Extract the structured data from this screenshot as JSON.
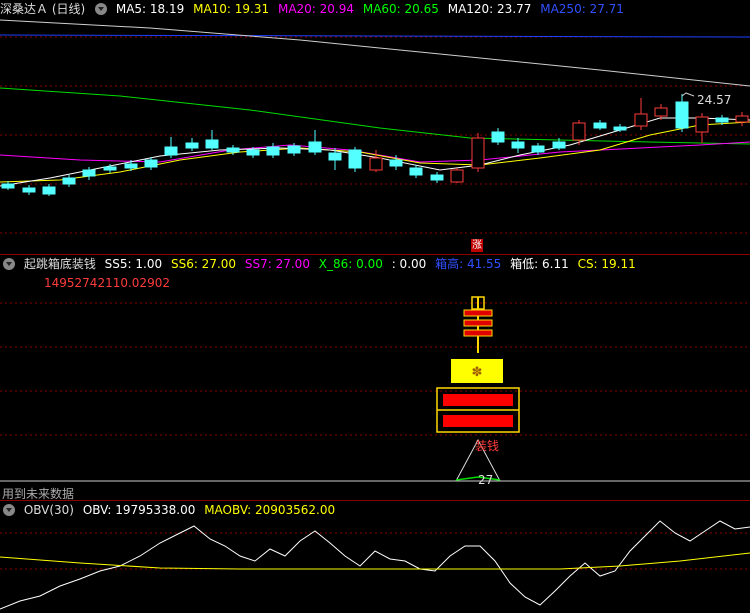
{
  "main": {
    "title": "深桑达Ａ (日线)",
    "ma": [
      {
        "label": "MA5: 18.19",
        "color": "#ffffff"
      },
      {
        "label": "MA10: 19.31",
        "color": "#ffff00"
      },
      {
        "label": "MA20: 20.94",
        "color": "#ff00ff"
      },
      {
        "label": "MA60: 20.65",
        "color": "#00ff00"
      },
      {
        "label": "MA120: 23.77",
        "color": "#ffffff"
      },
      {
        "label": "MA250: 27.71",
        "color": "#1e40ff"
      }
    ],
    "high_label": "24.57",
    "zhang_marker": "涨"
  },
  "indicator": {
    "title": "起跳箱底装钱",
    "items": [
      {
        "label": "SS5: 1.00",
        "color": "#ffffff"
      },
      {
        "label": "SS6: 27.00",
        "color": "#ffff00"
      },
      {
        "label": "SS7: 27.00",
        "color": "#ff00ff"
      },
      {
        "label": "X_86: 0.00",
        "color": "#00ff00"
      },
      {
        "label": ": 0.00",
        "color": "#ffffff"
      },
      {
        "label": "箱高: 41.55",
        "color": "#1e40ff"
      },
      {
        "label": "箱低: 6.11",
        "color": "#ffffff"
      },
      {
        "label": "CS: 19.11",
        "color": "#ffff00"
      }
    ],
    "red_number": "14952742110.02902",
    "zhuangqian_label": "装钱",
    "peak_value": "27",
    "footer": "用到未来数据"
  },
  "obv": {
    "title": "OBV(30)",
    "obv_label": "OBV: 19795338.00",
    "maobv_label": "MAOBV: 20903562.00"
  },
  "colors": {
    "up": "#ff3b3b",
    "down": "#54ffff",
    "grid": "#8b0000"
  }
}
